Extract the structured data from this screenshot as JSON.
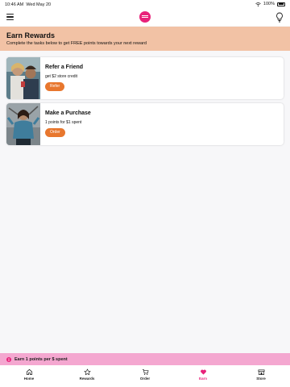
{
  "status_bar": {
    "time": "10:46 AM",
    "date": "Wed May 20",
    "battery": "100%"
  },
  "header": {
    "brand_color": "#e8227a"
  },
  "banner": {
    "title": "Earn Rewards",
    "subtitle": "Complete the tasks below to get FREE points towards your next reward",
    "background": "#f2c2a5"
  },
  "tasks": [
    {
      "title": "Refer a Friend",
      "description": "get $2 store credit",
      "button_label": "Refer"
    },
    {
      "title": "Make a Purchase",
      "description": "1 points for $1 spent",
      "button_label": "Order"
    }
  ],
  "promo_bar": {
    "text": "Earn 1 points per $ spent",
    "background": "#f4a7d0"
  },
  "tab_bar": {
    "items": [
      {
        "label": "Home",
        "icon": "home-icon"
      },
      {
        "label": "Rewards",
        "icon": "star-icon"
      },
      {
        "label": "Order",
        "icon": "cart-icon"
      },
      {
        "label": "Earn",
        "icon": "heart-icon",
        "active": true
      },
      {
        "label": "Store",
        "icon": "store-icon"
      }
    ]
  },
  "colors": {
    "accent": "#e8227a",
    "button": "#e8772e"
  }
}
